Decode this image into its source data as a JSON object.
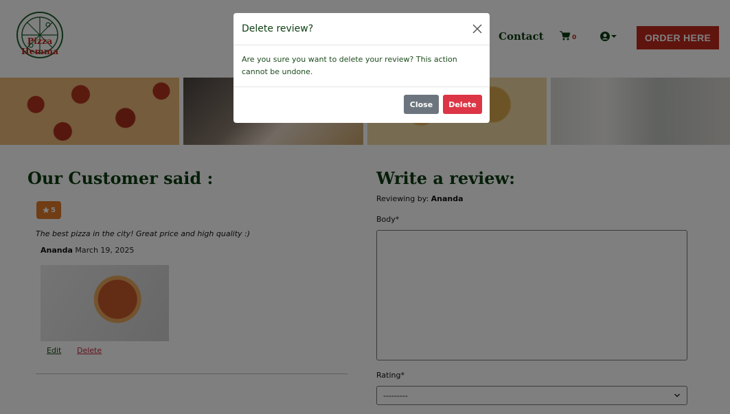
{
  "header": {
    "logo_text": "Pizza Hemma",
    "nav_contact": "Contact",
    "cart_count": "0",
    "order_button": "ORDER HERE"
  },
  "hero": {
    "images": [
      "pizza-pepperoni",
      "person-holding-pizza",
      "cheese-pizza",
      "friends-eating-pizza"
    ]
  },
  "reviews": {
    "title": "Our Customer said :",
    "items": [
      {
        "rating": "5",
        "body": "The best pizza in the city! Great price and high quality :)",
        "author": "Ananda",
        "date": "March 19, 2025",
        "edit_label": "Edit",
        "delete_label": "Delete"
      }
    ]
  },
  "form": {
    "title": "Write a review:",
    "reviewing_by_label": "Reviewing by:",
    "reviewing_by_user": "Ananda",
    "body_label": "Body*",
    "body_value": "",
    "rating_label": "Rating*",
    "rating_value": "---------"
  },
  "modal": {
    "title": "Delete review?",
    "message": "Are you sure you want to delete your review? This action cannot be undone.",
    "close_label": "Close",
    "delete_label": "Delete"
  },
  "colors": {
    "brand_red": "#c0281c",
    "dark_green": "#0c3d10",
    "danger": "#dc3545",
    "secondary": "#6c757d",
    "rating_orange": "#e07b2b"
  }
}
